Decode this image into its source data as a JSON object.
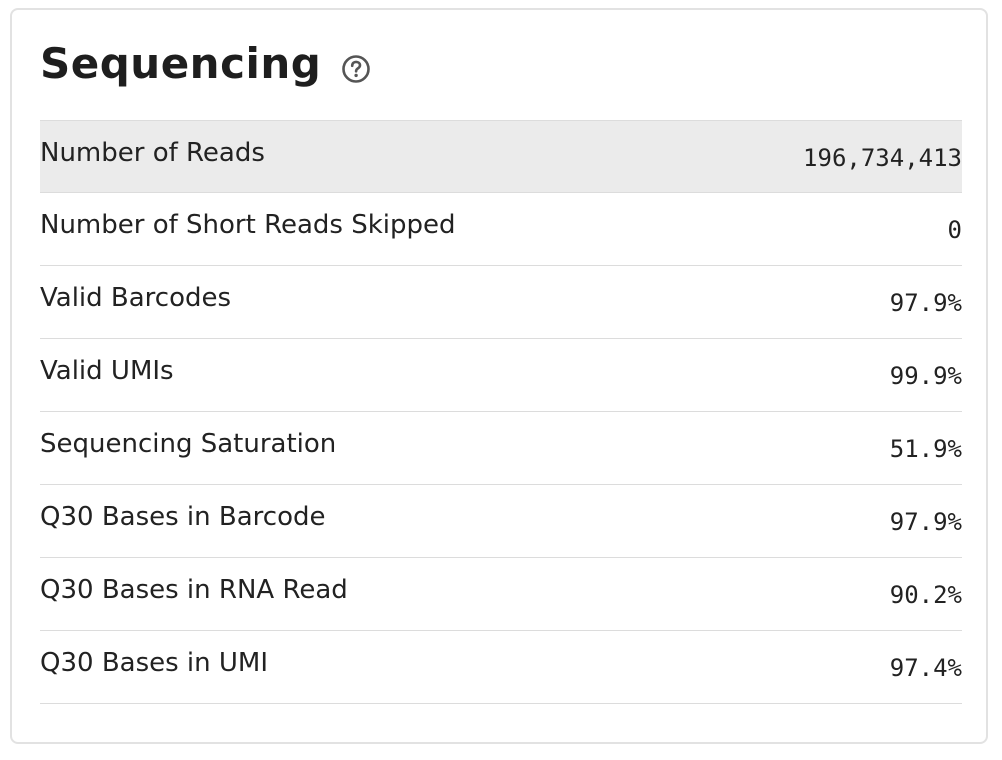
{
  "section": {
    "title": "Sequencing",
    "help_icon": "question-circle-icon"
  },
  "metrics": [
    {
      "label": "Number of Reads",
      "value": "196,734,413"
    },
    {
      "label": "Number of Short Reads Skipped",
      "value": "0"
    },
    {
      "label": "Valid Barcodes",
      "value": "97.9%"
    },
    {
      "label": "Valid UMIs",
      "value": "99.9%"
    },
    {
      "label": "Sequencing Saturation",
      "value": "51.9%"
    },
    {
      "label": "Q30 Bases in Barcode",
      "value": "97.9%"
    },
    {
      "label": "Q30 Bases in RNA Read",
      "value": "90.2%"
    },
    {
      "label": "Q30 Bases in UMI",
      "value": "97.4%"
    }
  ],
  "colors": {
    "highlight_row": "#ebebeb",
    "divider": "#dcdcdc",
    "text": "#222222",
    "icon": "#555555"
  }
}
